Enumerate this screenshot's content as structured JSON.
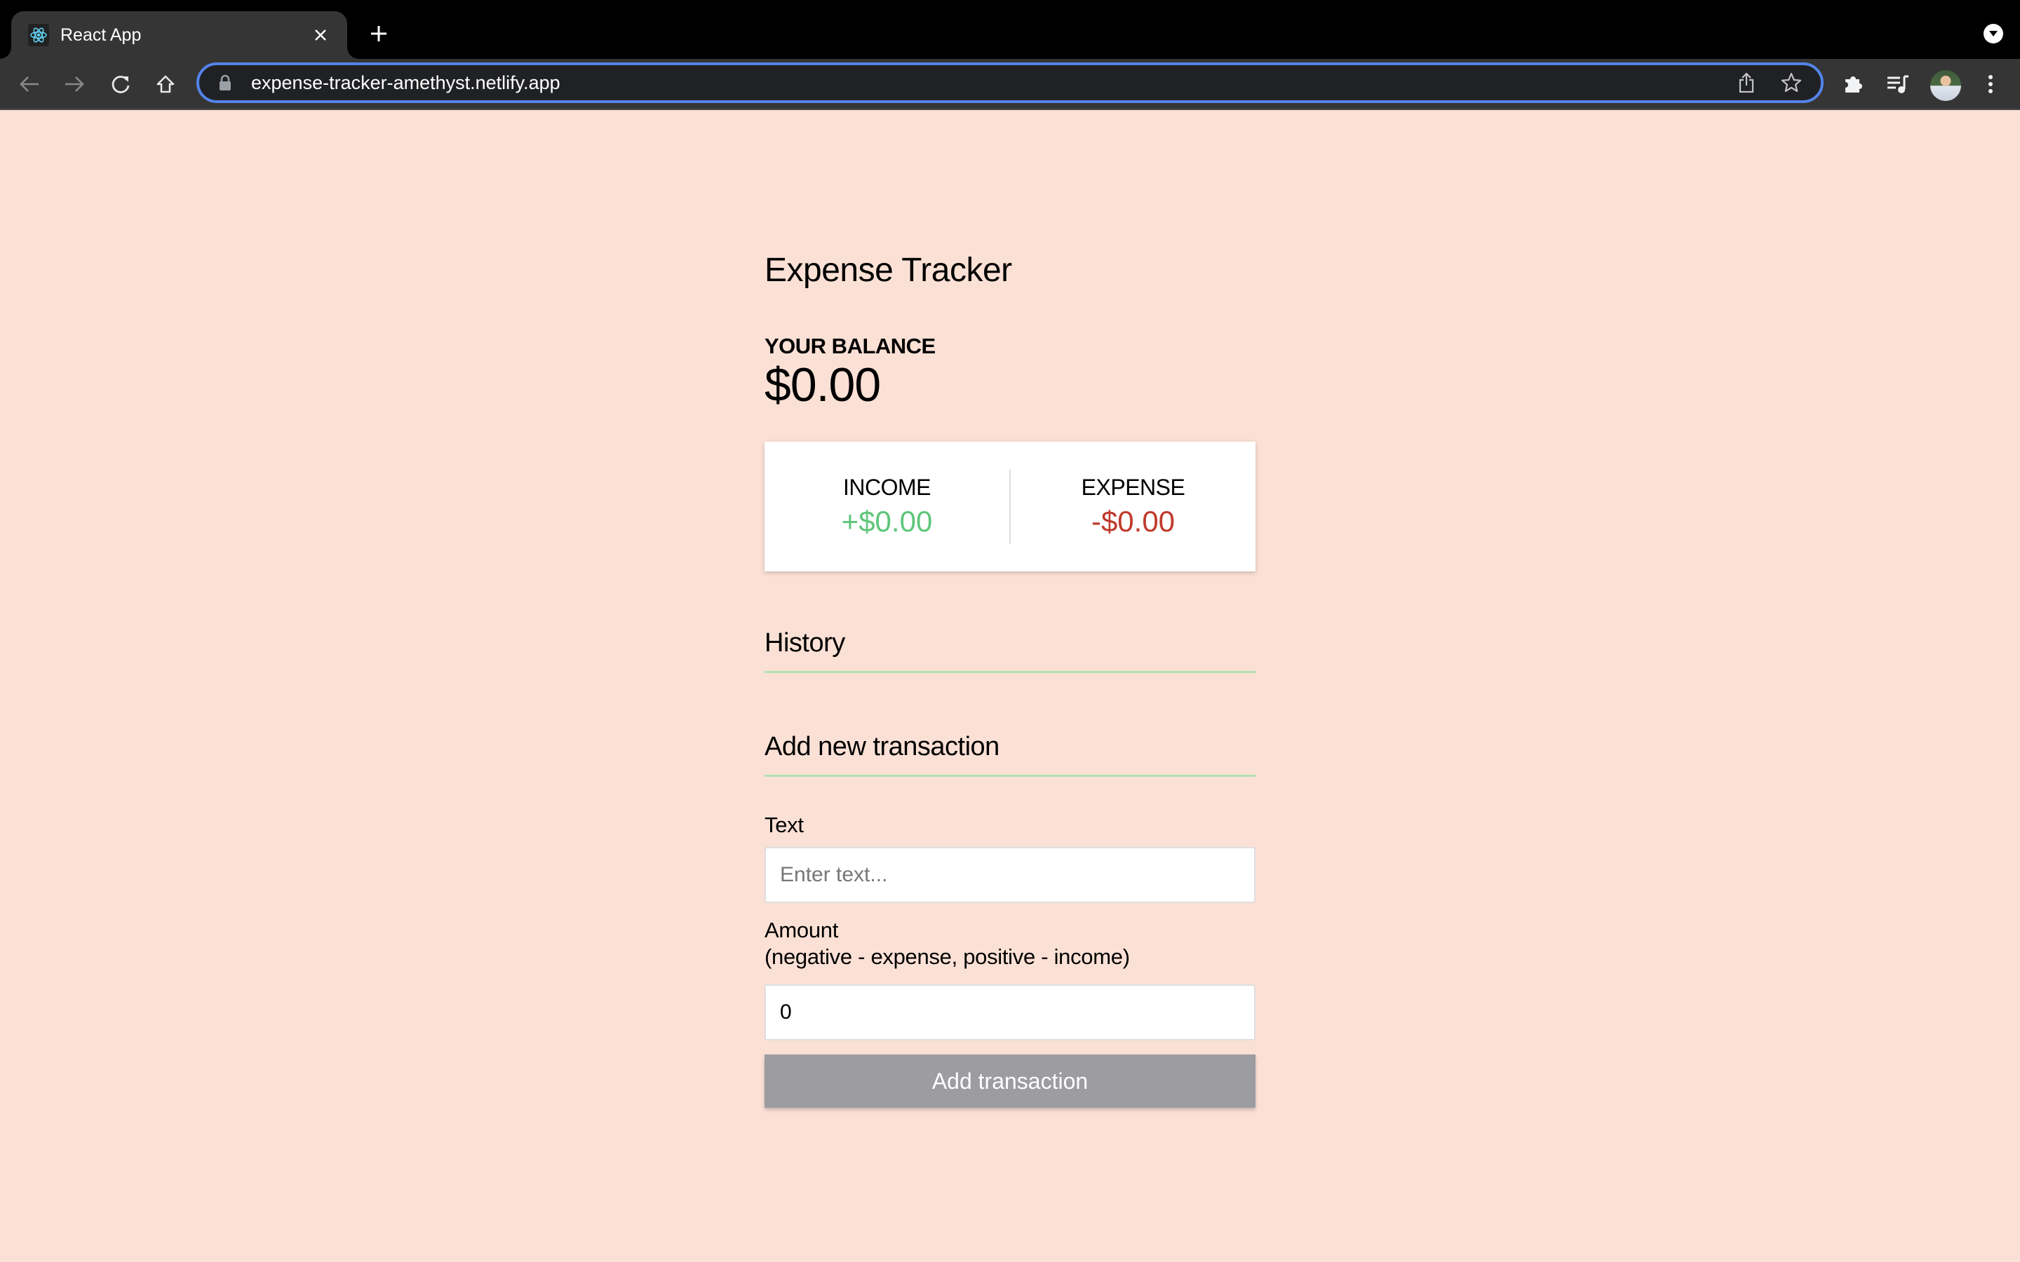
{
  "browser": {
    "tab": {
      "title": "React App",
      "favicon": "react-logo-icon",
      "close_icon": "close-icon"
    },
    "new_tab_icon": "plus-icon",
    "tab_search_icon": "chevron-down-circle-icon",
    "nav": {
      "back_icon": "arrow-left-icon",
      "forward_icon": "arrow-right-icon",
      "reload_icon": "reload-icon",
      "home_icon": "home-icon"
    },
    "omnibox": {
      "url": "expense-tracker-amethyst.netlify.app",
      "lock_icon": "lock-icon",
      "share_icon": "share-icon",
      "bookmark_icon": "star-icon"
    },
    "extensions_icon": "puzzle-icon",
    "media_icon": "playlist-icon",
    "profile_icon": "avatar",
    "menu_icon": "kebab-menu-icon"
  },
  "app": {
    "title": "Expense Tracker",
    "balance": {
      "label": "YOUR BALANCE",
      "value": "$0.00"
    },
    "summary": {
      "income": {
        "label": "INCOME",
        "value": "+$0.00"
      },
      "expense": {
        "label": "EXPENSE",
        "value": "-$0.00"
      }
    },
    "history": {
      "title": "History",
      "items": []
    },
    "add_transaction": {
      "title": "Add new transaction",
      "text_field": {
        "label": "Text",
        "placeholder": "Enter text...",
        "value": ""
      },
      "amount_field": {
        "label": "Amount",
        "hint": "(negative - expense, positive - income)",
        "value": "0"
      },
      "submit_label": "Add transaction"
    }
  },
  "colors": {
    "page_background": "#fbe0d5",
    "income": "#5fc67a",
    "expense": "#c0392b",
    "divider": "#b1e2b3",
    "button": "#9c9ca1",
    "omnibox_focus": "#5383e8"
  }
}
